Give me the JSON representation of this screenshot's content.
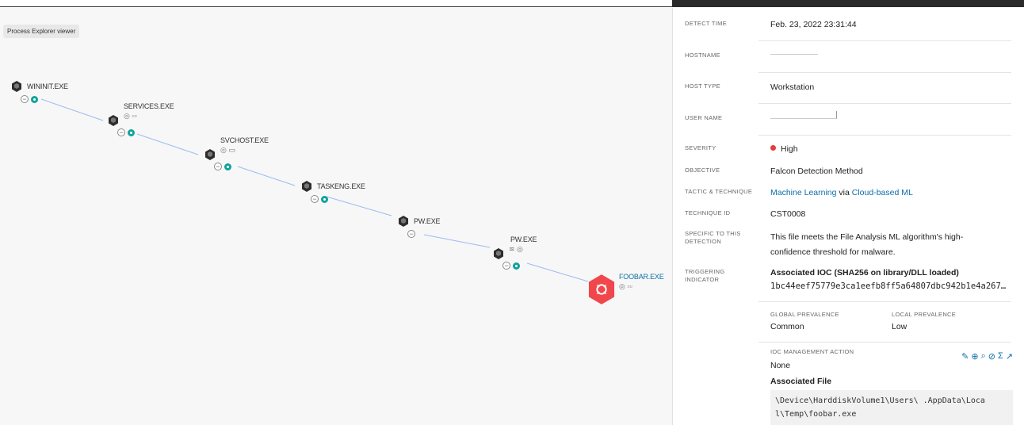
{
  "graph": {
    "viewer_label": "Process Explorer viewer",
    "nodes": [
      {
        "name": "WININIT.EXE",
        "glyphs": ""
      },
      {
        "name": "SERVICES.EXE",
        "glyphs": "◎ ▫▫"
      },
      {
        "name": "SVCHOST.EXE",
        "glyphs": "◎ ▭"
      },
      {
        "name": "TASKENG.EXE",
        "glyphs": ""
      },
      {
        "name": "PW.EXE",
        "glyphs": ""
      },
      {
        "name": "PW.EXE",
        "glyphs": "≋ ◎"
      },
      {
        "name": "FOOBAR.EXE",
        "glyphs": "◎ ▫▫"
      }
    ]
  },
  "details": {
    "detect_time": {
      "label": "DETECT TIME",
      "value": "Feb. 23, 2022 23:31:44"
    },
    "hostname": {
      "label": "HOSTNAME",
      "value": ""
    },
    "host_type": {
      "label": "HOST TYPE",
      "value": "Workstation"
    },
    "user_name": {
      "label": "USER NAME",
      "value": ""
    },
    "severity": {
      "label": "SEVERITY",
      "value": "High",
      "color": "#e83a3a"
    },
    "objective": {
      "label": "OBJECTIVE",
      "value": "Falcon Detection Method"
    },
    "tactic": {
      "label": "TACTIC & TECHNIQUE",
      "tactic": "Machine Learning",
      "via": "via",
      "technique": "Cloud-based ML"
    },
    "technique_id": {
      "label": "TECHNIQUE ID",
      "value": "CST0008"
    },
    "specific": {
      "label_1": "SPECIFIC TO THIS",
      "label_2": "DETECTION",
      "line_1": "This file meets the File Analysis ML algorithm's high-",
      "line_2": "confidence threshold for malware."
    },
    "triggering": {
      "label_1": "TRIGGERING",
      "label_2": "INDICATOR",
      "title": "Associated IOC (SHA256 on library/DLL loaded)",
      "hash": "1bc44eef75779e3ca1eefb8ff5a64807dbc942b1e4a267…"
    },
    "global_prevalence": {
      "label": "GLOBAL PREVALENCE",
      "value": "Common"
    },
    "local_prevalence": {
      "label": "LOCAL PREVALENCE",
      "value": "Low"
    },
    "ioc_action": {
      "label": "IOC MANAGEMENT ACTION",
      "value": "None"
    },
    "associated_file": {
      "title": "Associated File",
      "line_1": "\\Device\\HarddiskVolume1\\Users\\       .AppData\\Loca",
      "line_2": "l\\Temp\\foobar.exe"
    }
  },
  "colors": {
    "accent": "#0b6fa8",
    "edge": "#9dbbf0",
    "alert": "#f0474c",
    "teal": "#11a39a"
  }
}
